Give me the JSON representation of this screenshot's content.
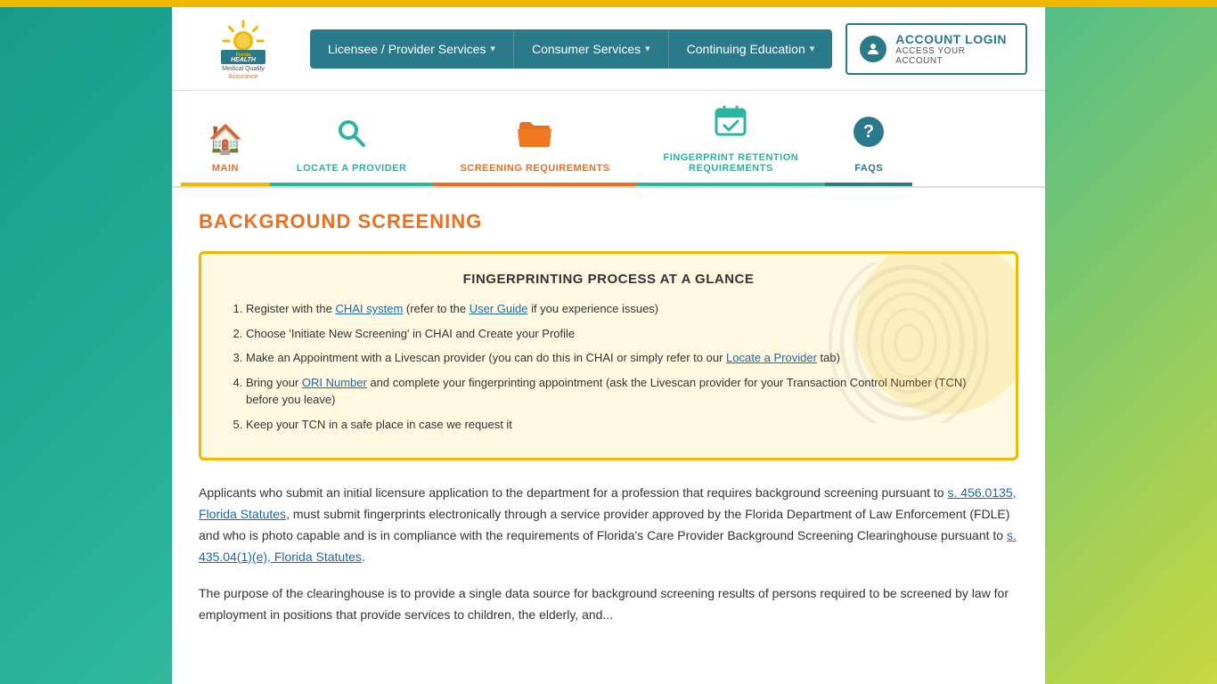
{
  "topBar": {},
  "header": {
    "logo": {
      "florida": "Florida",
      "health": "HEALTH",
      "medical": "Medical Quality",
      "assurance": "Assurance"
    },
    "nav": {
      "items": [
        {
          "id": "licensee",
          "label": "Licensee / Provider Services",
          "hasDropdown": true
        },
        {
          "id": "consumer",
          "label": "Consumer Services",
          "hasDropdown": true
        },
        {
          "id": "continuing",
          "label": "Continuing Education",
          "hasDropdown": true
        }
      ]
    },
    "account": {
      "login_label": "ACCOUNT LOGIN",
      "sub_label": "ACCESS YOUR ACCOUNT"
    }
  },
  "iconNav": {
    "items": [
      {
        "id": "main",
        "label": "MAIN",
        "icon": "🏠",
        "colorClass": "label-orange",
        "activeClass": "active-main"
      },
      {
        "id": "locate",
        "label": "LOCATE A PROVIDER",
        "icon": "🔍",
        "colorClass": "label-teal",
        "activeClass": "active-locate"
      },
      {
        "id": "screening",
        "label": "SCREENING REQUIREMENTS",
        "icon": "📂",
        "colorClass": "label-orange",
        "activeClass": "active-screening"
      },
      {
        "id": "fingerprint",
        "label": "FINGERPRINT RETENTION\nREQUIREMENTS",
        "icon": "📅",
        "colorClass": "label-teal",
        "activeClass": "active-fingerprint"
      },
      {
        "id": "faqs",
        "label": "FAQS",
        "icon": "❓",
        "colorClass": "label-dark-teal",
        "activeClass": "active-faqs"
      }
    ]
  },
  "content": {
    "section_title": "BACKGROUND SCREENING",
    "fingerprintBox": {
      "title": "FINGERPRINTING PROCESS AT A GLANCE",
      "steps": [
        {
          "id": 1,
          "text_before": "Register with the ",
          "link1_text": "CHAI system",
          "text_middle": " (refer to the ",
          "link2_text": "User Guide",
          "text_after": " if you experience issues)"
        },
        {
          "id": 2,
          "text": "Choose 'Initiate New Screening' in CHAI and Create your Profile"
        },
        {
          "id": 3,
          "text_before": "Make an Appointment with a Livescan provider (you can do this in CHAI or simply refer to our ",
          "link1_text": "Locate a Provider",
          "text_after": " tab)"
        },
        {
          "id": 4,
          "text_before": "Bring your ",
          "link1_text": "ORI Number",
          "text_after": " and complete your fingerprinting appointment (ask the Livescan provider for your Transaction Control Number (TCN) before you leave)"
        },
        {
          "id": 5,
          "text": "Keep your TCN in a safe place in case we request it"
        }
      ]
    },
    "paragraph1_before": "Applicants who submit an initial licensure application to the department for a profession that requires background screening pursuant to ",
    "paragraph1_link": "s. 456.0135, Florida Statutes",
    "paragraph1_after": ", must submit fingerprints electronically through a service provider approved by the Florida Department of Law Enforcement (FDLE) and who is photo capable and is in compliance with the requirements of Florida's Care Provider Background Screening Clearinghouse pursuant to ",
    "paragraph1_link2": "s. 435.04(1)(e), Florida Statutes",
    "paragraph1_end": ".",
    "paragraph2": "The purpose of the clearinghouse is to provide a single data source for background screening results of persons required to be screened by law for employment in positions that provide services to children, the elderly, and..."
  }
}
